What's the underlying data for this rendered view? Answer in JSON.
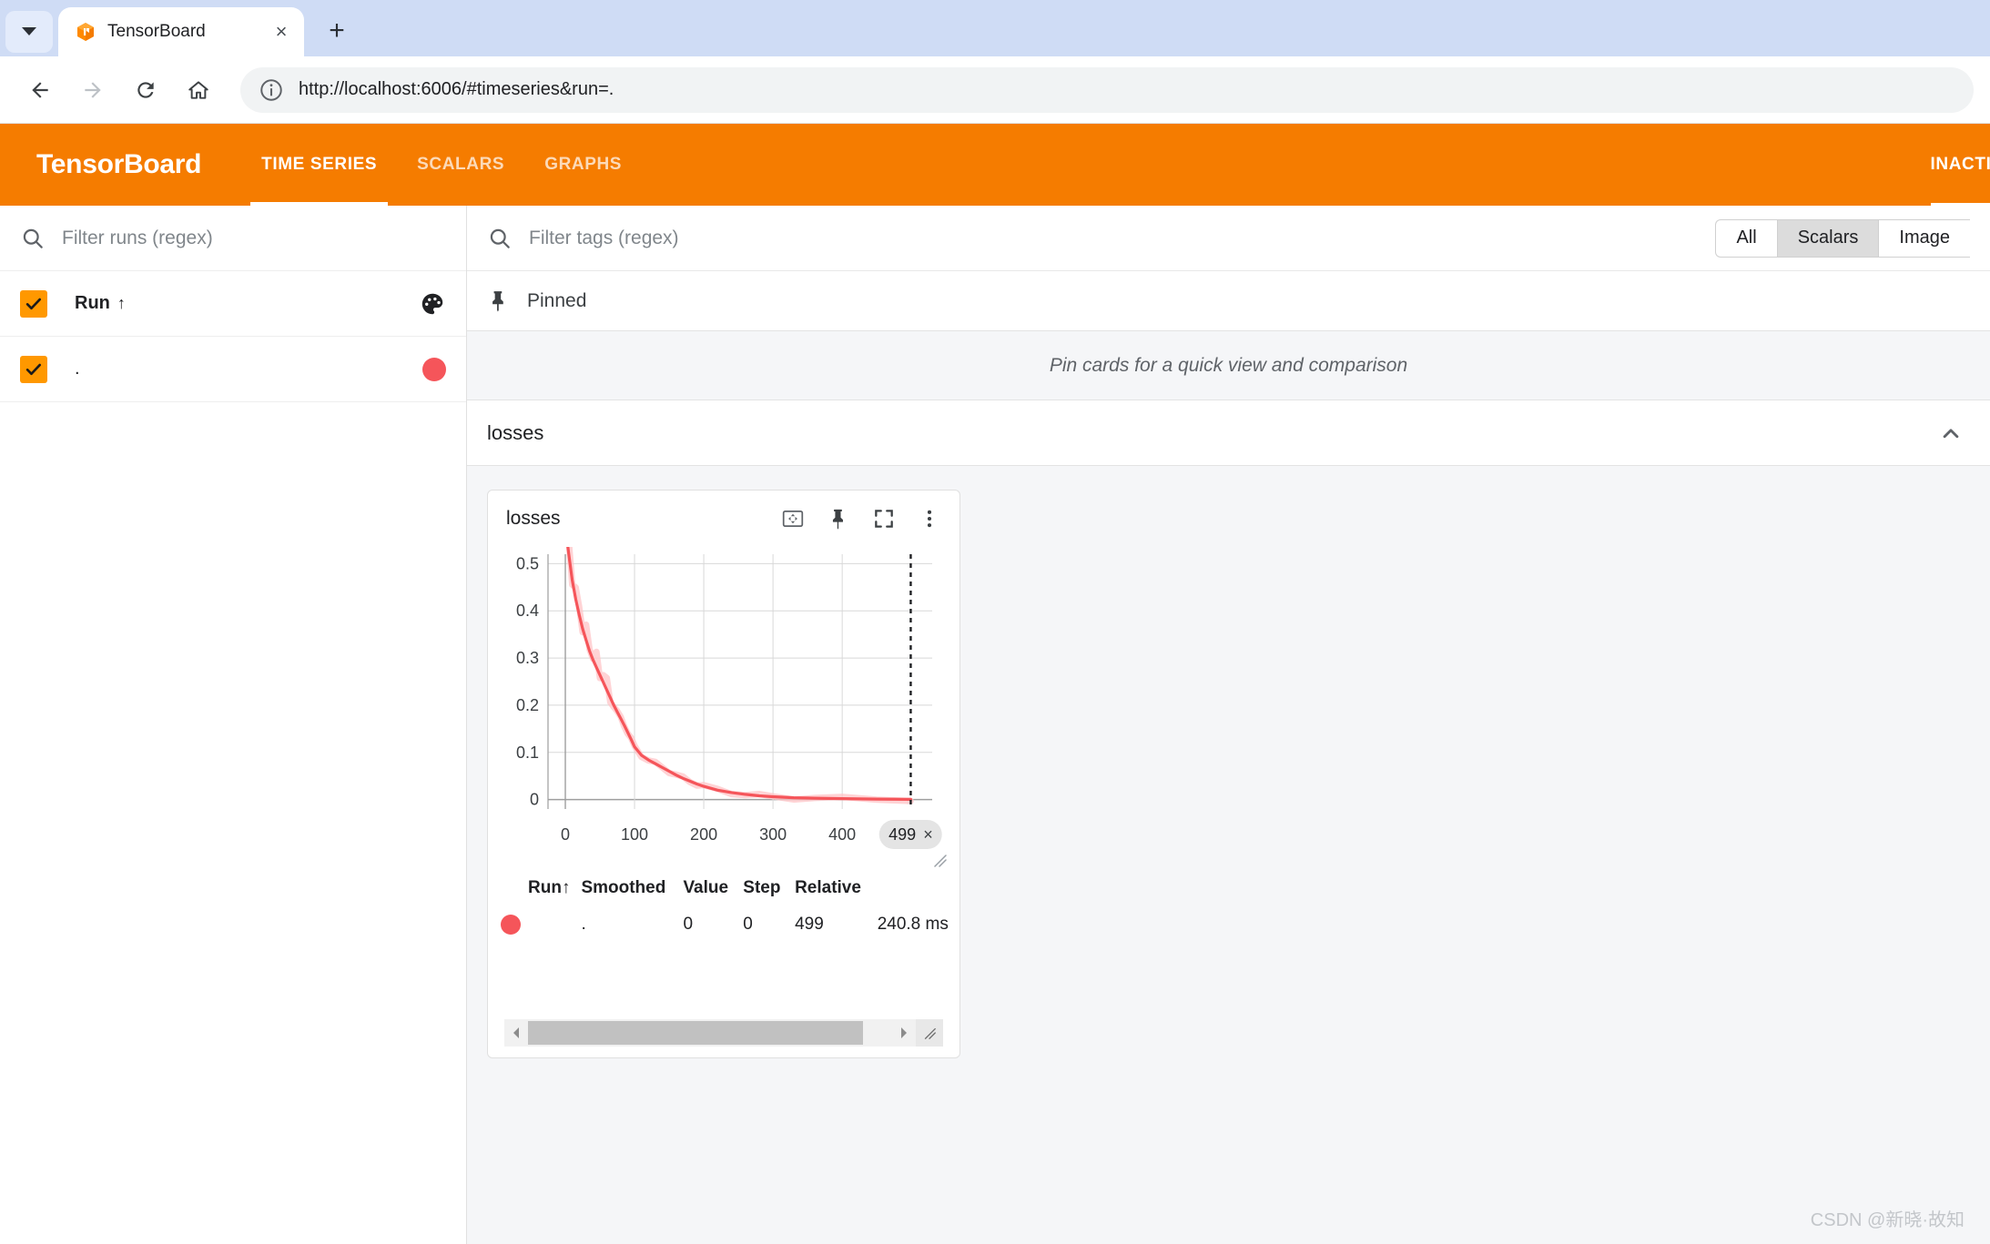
{
  "browser": {
    "tab_title": "TensorBoard",
    "tab_close_label": "×",
    "new_tab_label": "+",
    "url": "http://localhost:6006/#timeseries&run=."
  },
  "tb_header": {
    "logo": "TensorBoard",
    "tabs": [
      {
        "label": "TIME SERIES",
        "active": true
      },
      {
        "label": "SCALARS",
        "active": false
      },
      {
        "label": "GRAPHS",
        "active": false
      }
    ],
    "inactive_label": "INACTIVE",
    "accent_color": "#f57c00"
  },
  "sidebar": {
    "filter_placeholder": "Filter runs (regex)",
    "run_column_header": "Run",
    "sort_arrow": "↑",
    "runs": [
      {
        "name": ".",
        "color": "#f5555a",
        "checked": true
      }
    ]
  },
  "content": {
    "tag_filter_placeholder": "Filter tags (regex)",
    "toggles": [
      {
        "label": "All",
        "selected": false
      },
      {
        "label": "Scalars",
        "selected": true
      },
      {
        "label": "Image",
        "selected": false
      }
    ],
    "pinned_label": "Pinned",
    "pinned_empty_text": "Pin cards for a quick view and comparison",
    "group_title": "losses"
  },
  "card": {
    "title": "losses",
    "icons": [
      "fit-to-domain-icon",
      "pin-icon",
      "fullscreen-icon",
      "more-options-icon"
    ],
    "step_chip": "499",
    "chip_close": "×",
    "table": {
      "headers": [
        "Run",
        "Smoothed",
        "Value",
        "Step",
        "Relative"
      ],
      "sort_arrow": "↑",
      "rows": [
        {
          "color": "#f5555a",
          "run": ".",
          "smoothed": "0",
          "value": "0",
          "step": "499",
          "relative": "240.8 ms"
        }
      ]
    }
  },
  "chart_data": {
    "type": "line",
    "title": "losses",
    "xlabel": "",
    "ylabel": "",
    "xlim": [
      -25,
      530
    ],
    "ylim": [
      -0.02,
      0.52
    ],
    "xticks": [
      0,
      100,
      200,
      300,
      400
    ],
    "yticks": [
      0.5,
      0.4,
      0.3,
      0.2,
      0.1,
      0
    ],
    "ytick_labels": [
      "0.5",
      "0.4",
      "0.3",
      "0.2",
      "0.1",
      "0"
    ],
    "grid": true,
    "legend": false,
    "marker_step": 499,
    "series": [
      {
        "name": ".",
        "color": "#f5555a",
        "band_color": "#ffc4c7",
        "x": [
          0,
          5,
          10,
          15,
          20,
          25,
          30,
          35,
          40,
          45,
          50,
          55,
          60,
          65,
          70,
          75,
          80,
          85,
          90,
          95,
          100,
          110,
          120,
          130,
          140,
          150,
          160,
          170,
          180,
          190,
          200,
          220,
          240,
          260,
          280,
          300,
          330,
          360,
          400,
          450,
          499
        ],
        "y": [
          0.58,
          0.52,
          0.465,
          0.425,
          0.392,
          0.362,
          0.338,
          0.315,
          0.296,
          0.28,
          0.264,
          0.248,
          0.232,
          0.216,
          0.2,
          0.186,
          0.172,
          0.158,
          0.143,
          0.128,
          0.112,
          0.094,
          0.084,
          0.076,
          0.068,
          0.06,
          0.052,
          0.045,
          0.039,
          0.033,
          0.028,
          0.02,
          0.015,
          0.011,
          0.008,
          0.006,
          0.004,
          0.003,
          0.002,
          0.001,
          0.0005
        ]
      }
    ]
  },
  "watermark": "CSDN @新晓·故知"
}
